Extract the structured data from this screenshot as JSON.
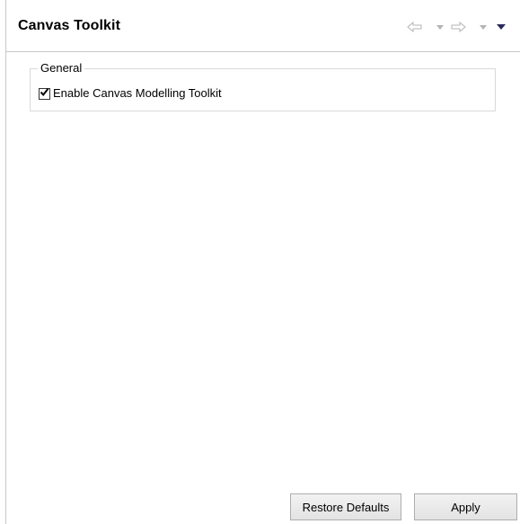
{
  "header": {
    "title": "Canvas Toolkit",
    "nav_icons": [
      "back-arrow-icon",
      "chevron-down-icon",
      "forward-arrow-icon",
      "chevron-down-icon",
      "view-menu-icon"
    ]
  },
  "general_group": {
    "legend": "General",
    "checkbox": {
      "label": "Enable Canvas Modelling Toolkit",
      "checked": true
    }
  },
  "buttons": {
    "restore_defaults": "Restore Defaults",
    "apply": "Apply"
  },
  "colors": {
    "border": "#c8c8c8",
    "nav_disabled": "#b4b4b4",
    "button_border": "#adadad"
  }
}
